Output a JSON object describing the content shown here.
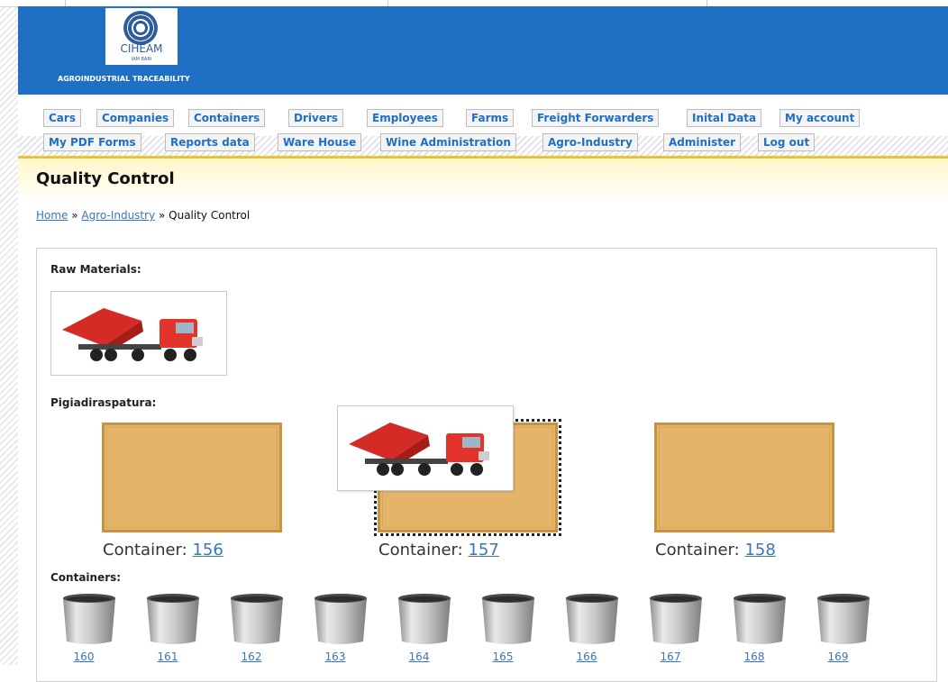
{
  "header": {
    "logo_text": "CIHEAM",
    "logo_subtext": "IAM BARI",
    "slogan": "AGROINDUSTRIAL TRACEABILITY"
  },
  "nav": {
    "row1": [
      "Cars",
      "Companies",
      "Containers",
      "Drivers",
      "Employees",
      "Farms",
      "Freight Forwarders",
      "Inital Data",
      "My account"
    ],
    "row2": [
      "My PDF Forms",
      "Reports data",
      "Ware House",
      "Wine Administration",
      "Agro-Industry",
      "Administer",
      "Log out"
    ]
  },
  "page": {
    "title": "Quality Control",
    "breadcrumb": [
      "Home",
      "Agro-Industry",
      "Quality Control"
    ],
    "breadcrumb_sep": " » "
  },
  "raw_materials": {
    "label": "Raw Materials:",
    "image": "red-dump-truck"
  },
  "pigiadiraspatura": {
    "label": "Pigiadiraspatura:",
    "caption_prefix": "Container: ",
    "containers": [
      "156",
      "157",
      "158"
    ],
    "selected": "157",
    "dragging_image": "red-dump-truck"
  },
  "containers_section": {
    "label": "Containers:",
    "items": [
      "160",
      "161",
      "162",
      "163",
      "164",
      "165",
      "166",
      "167",
      "168",
      "169"
    ]
  },
  "colors": {
    "header_blue": "#1f6fc4",
    "link_blue": "#3b76b7",
    "bin_fill": "#e5b46b",
    "bin_border": "#c8933e",
    "title_bar_accent": "#e8c33c"
  }
}
